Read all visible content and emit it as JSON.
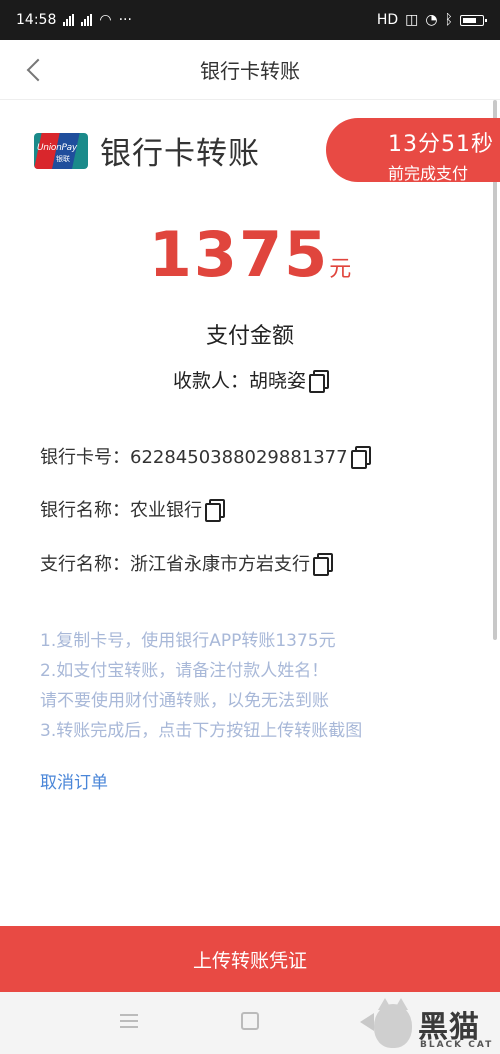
{
  "status_bar": {
    "time": "14:58",
    "dots": "···",
    "hd": "HD"
  },
  "nav": {
    "title": "银行卡转账"
  },
  "card": {
    "logo_text": "UnionPay",
    "logo_cn": "银联",
    "title": "银行卡转账"
  },
  "timer": {
    "time": "13分51秒",
    "note": "前完成支付"
  },
  "payment": {
    "amount": "1375",
    "unit": "元",
    "amount_label": "支付金额",
    "payee_label": "收款人：",
    "payee_name": "胡晓姿"
  },
  "details": {
    "card_label": "银行卡号：",
    "card_number": "6228450388029881377",
    "bank_label": "银行名称：",
    "bank_name": "农业银行",
    "branch_label": "支行名称：",
    "branch_name": "浙江省永康市方岩支行"
  },
  "notes": [
    "1.复制卡号，使用银行APP转账1375元",
    "2.如支付宝转账，请备注付款人姓名！",
    "请不要使用财付通转账，以免无法到账",
    "3.转账完成后，点击下方按钮上传转账截图"
  ],
  "actions": {
    "cancel": "取消订单",
    "upload": "上传转账凭证"
  },
  "watermark": {
    "cn": "黑猫",
    "en": "BLACK CAT"
  },
  "colors": {
    "accent_red": "#e84a44",
    "amount_red": "#e0453d",
    "link_blue": "#4a86d8",
    "note_text": "#a8b8d8"
  }
}
